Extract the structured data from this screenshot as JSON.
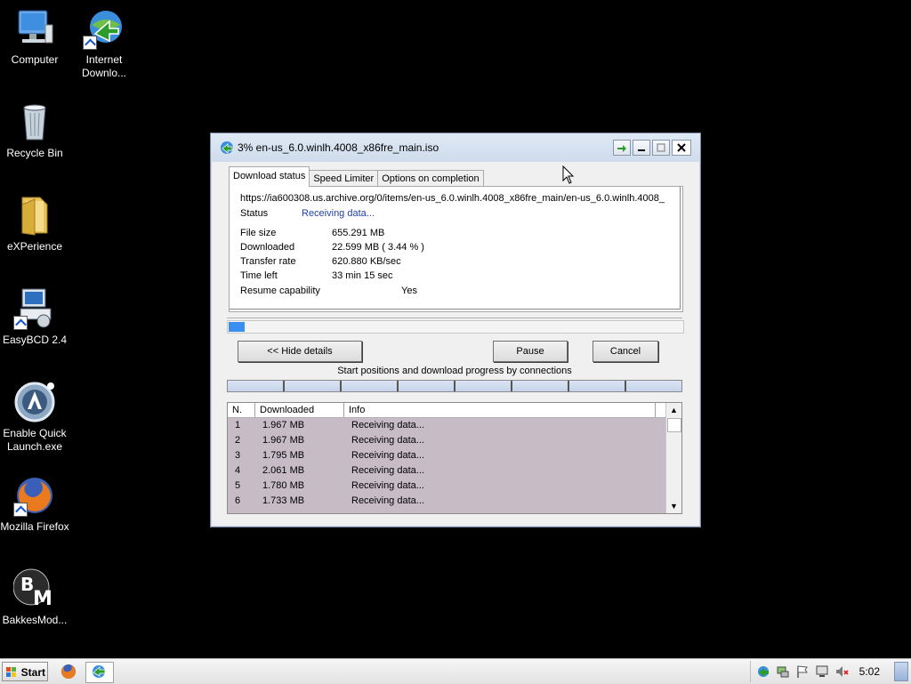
{
  "desktop": {
    "icons": [
      {
        "label": "Computer"
      },
      {
        "label": "Internet Downlo..."
      },
      {
        "label": "Recycle Bin"
      },
      {
        "label": "eXPerience"
      },
      {
        "label": "EasyBCD 2.4"
      },
      {
        "label": "Enable Quick Launch.exe"
      },
      {
        "label": "Mozilla Firefox"
      },
      {
        "label": "BakkesMod..."
      }
    ]
  },
  "window": {
    "title": "3% en-us_6.0.winlh.4008_x86fre_main.iso",
    "tabs": [
      "Download status",
      "Speed Limiter",
      "Options on completion"
    ],
    "url": "https://ia600308.us.archive.org/0/items/en-us_6.0.winlh.4008_x86fre_main/en-us_6.0.winlh.4008_",
    "status_label": "Status",
    "status_value": "Receiving data...",
    "file_size_label": "File size",
    "file_size_value": "655.291  MB",
    "downloaded_label": "Downloaded",
    "downloaded_value": "22.599  MB  ( 3.44 % )",
    "transfer_rate_label": "Transfer rate",
    "transfer_rate_value": "620.880  KB/sec",
    "time_left_label": "Time left",
    "time_left_value": "33 min 15 sec",
    "resume_label": "Resume capability",
    "resume_value": "Yes",
    "progress_fraction": 0.0344,
    "hide_details_label": "<< Hide details",
    "pause_label": "Pause",
    "cancel_label": "Cancel",
    "connections_caption": "Start positions and download progress by connections",
    "connections_count": 8,
    "table": {
      "headers": [
        "N.",
        "Downloaded",
        "Info"
      ],
      "rows": [
        [
          "1",
          "1.967  MB",
          "Receiving data..."
        ],
        [
          "2",
          "1.967  MB",
          "Receiving data..."
        ],
        [
          "3",
          "1.795  MB",
          "Receiving data..."
        ],
        [
          "4",
          "2.061  MB",
          "Receiving data..."
        ],
        [
          "5",
          "1.780  MB",
          "Receiving data..."
        ],
        [
          "6",
          "1.733  MB",
          "Receiving data..."
        ]
      ]
    }
  },
  "taskbar": {
    "start_label": "Start",
    "clock": "5:02"
  },
  "colors": {
    "status_text": "#1f3fa8",
    "progress_fill": "#3a8ef0",
    "table_rows_bg": "#c7bcc6"
  }
}
